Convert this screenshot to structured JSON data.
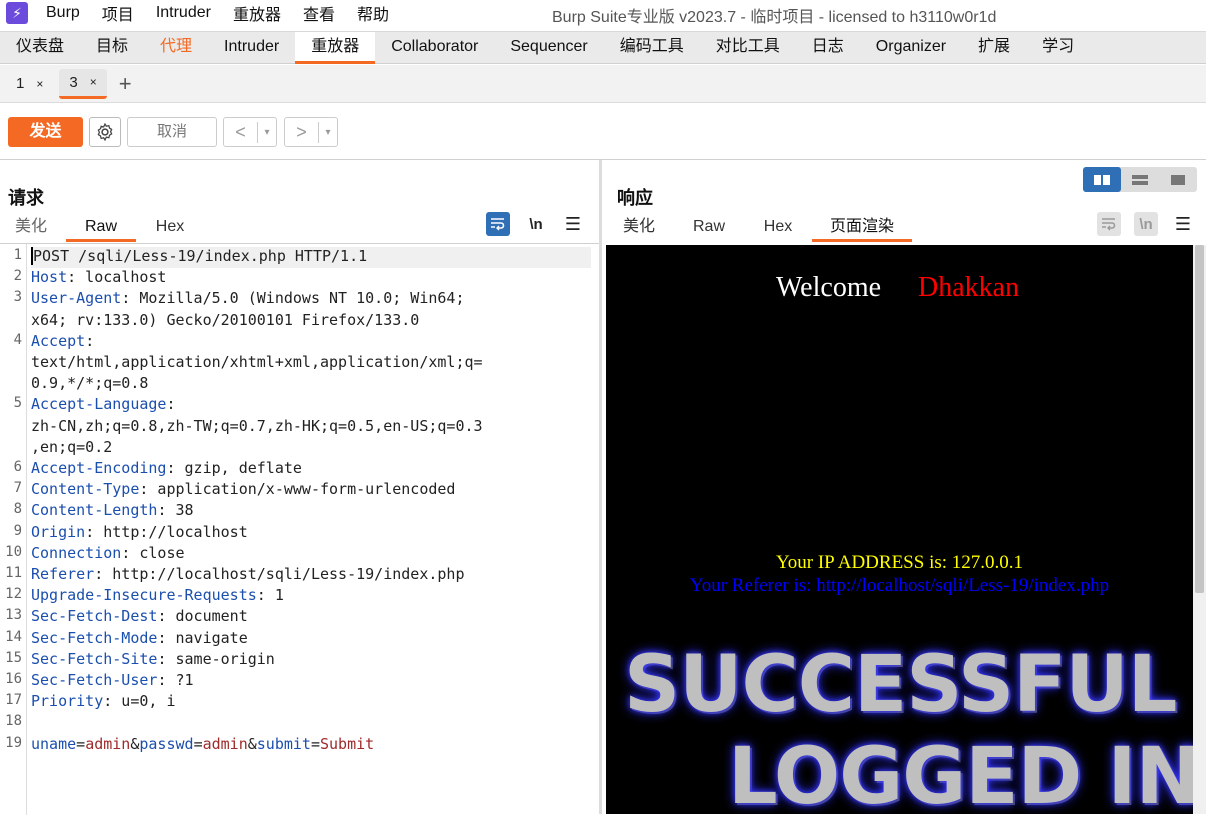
{
  "app": {
    "menu": [
      "Burp",
      "项目",
      "Intruder",
      "重放器",
      "查看",
      "帮助"
    ],
    "window_title": "Burp Suite专业版  v2023.7 - 临时项目 - licensed to h3110w0r1d",
    "logo_glyph": "⚡"
  },
  "main_tabs": [
    "仪表盘",
    "目标",
    "代理",
    "Intruder",
    "重放器",
    "Collaborator",
    "Sequencer",
    "编码工具",
    "对比工具",
    "日志",
    "Organizer",
    "扩展",
    "学习"
  ],
  "sub_tabs": [
    {
      "label": "1",
      "close": "×"
    },
    {
      "label": "3",
      "close": "×"
    }
  ],
  "sub_tab_add": "+",
  "toolbar": {
    "send_label": "发送",
    "cancel_label": "取消",
    "back_glyph": "<",
    "forward_glyph": ">",
    "dropdown_glyph": "▾"
  },
  "request": {
    "title": "请求",
    "tabs": [
      "美化",
      "Raw",
      "Hex"
    ],
    "active_tab": "Raw",
    "lines": [
      {
        "n": "1",
        "parts": [
          [
            "POST /sqli/Less-19/index.php HTTP/1.1",
            ""
          ]
        ]
      },
      {
        "n": "2",
        "parts": [
          [
            "Host",
            "k"
          ],
          [
            ": localhost",
            ""
          ]
        ]
      },
      {
        "n": "3",
        "parts": [
          [
            "User-Agent",
            "k"
          ],
          [
            ": Mozilla/5.0 (Windows NT 10.0; Win64;",
            ""
          ]
        ]
      },
      {
        "n": "",
        "parts": [
          [
            "x64; rv:133.0) Gecko/20100101 Firefox/133.0",
            ""
          ]
        ]
      },
      {
        "n": "4",
        "parts": [
          [
            "Accept",
            "k"
          ],
          [
            ":",
            ""
          ]
        ]
      },
      {
        "n": "",
        "parts": [
          [
            "text/html,application/xhtml+xml,application/xml;q=",
            ""
          ]
        ]
      },
      {
        "n": "",
        "parts": [
          [
            "0.9,*/*;q=0.8",
            ""
          ]
        ]
      },
      {
        "n": "5",
        "parts": [
          [
            "Accept-Language",
            "k"
          ],
          [
            ":",
            ""
          ]
        ]
      },
      {
        "n": "",
        "parts": [
          [
            "zh-CN,zh;q=0.8,zh-TW;q=0.7,zh-HK;q=0.5,en-US;q=0.3",
            ""
          ]
        ]
      },
      {
        "n": "",
        "parts": [
          [
            ",en;q=0.2",
            ""
          ]
        ]
      },
      {
        "n": "6",
        "parts": [
          [
            "Accept-Encoding",
            "k"
          ],
          [
            ": gzip, deflate",
            ""
          ]
        ]
      },
      {
        "n": "7",
        "parts": [
          [
            "Content-Type",
            "k"
          ],
          [
            ": application/x-www-form-urlencoded",
            ""
          ]
        ]
      },
      {
        "n": "8",
        "parts": [
          [
            "Content-Length",
            "k"
          ],
          [
            ": 38",
            ""
          ]
        ]
      },
      {
        "n": "9",
        "parts": [
          [
            "Origin",
            "k"
          ],
          [
            ": http://localhost",
            ""
          ]
        ]
      },
      {
        "n": "10",
        "parts": [
          [
            "Connection",
            "k"
          ],
          [
            ": close",
            ""
          ]
        ]
      },
      {
        "n": "11",
        "parts": [
          [
            "Referer",
            "k"
          ],
          [
            ": http://localhost/sqli/Less-19/index.php",
            ""
          ]
        ]
      },
      {
        "n": "12",
        "parts": [
          [
            "Upgrade-Insecure-Requests",
            "k"
          ],
          [
            ": 1",
            ""
          ]
        ]
      },
      {
        "n": "13",
        "parts": [
          [
            "Sec-Fetch-Dest",
            "k"
          ],
          [
            ": document",
            ""
          ]
        ]
      },
      {
        "n": "14",
        "parts": [
          [
            "Sec-Fetch-Mode",
            "k"
          ],
          [
            ": navigate",
            ""
          ]
        ]
      },
      {
        "n": "15",
        "parts": [
          [
            "Sec-Fetch-Site",
            "k"
          ],
          [
            ": same-origin",
            ""
          ]
        ]
      },
      {
        "n": "16",
        "parts": [
          [
            "Sec-Fetch-User",
            "k"
          ],
          [
            ": ?1",
            ""
          ]
        ]
      },
      {
        "n": "17",
        "parts": [
          [
            "Priority",
            "k"
          ],
          [
            ": u=0, i",
            ""
          ]
        ]
      },
      {
        "n": "18",
        "parts": []
      },
      {
        "n": "19",
        "parts": [
          [
            "uname",
            "k"
          ],
          [
            "=",
            ""
          ],
          [
            "admin",
            "pv"
          ],
          [
            "&",
            ""
          ],
          [
            "passwd",
            "k"
          ],
          [
            "=",
            ""
          ],
          [
            "admin",
            "pv"
          ],
          [
            "&",
            ""
          ],
          [
            "submit",
            "k"
          ],
          [
            "=",
            ""
          ],
          [
            "Submit",
            "pv"
          ]
        ]
      }
    ]
  },
  "response": {
    "title": "响应",
    "tabs": [
      "美化",
      "Raw",
      "Hex",
      "页面渲染"
    ],
    "active_tab": "页面渲染",
    "render": {
      "welcome": "Welcome",
      "name": "Dhakkan",
      "ip_line": "Your IP ADDRESS is: 127.0.0.1",
      "referer_line": "Your Referer is: http://localhost/sqli/Less-19/index.php",
      "banner_line1": "SUCCESSFUL",
      "banner_line2": "LOGGED IN"
    }
  },
  "icons": {
    "wrap": "wrap-lines-icon",
    "newline": "\\n",
    "menu": "☰"
  },
  "colors": {
    "accent": "#f46a24",
    "header_key": "#1b4fae",
    "param_value": "#9e2a2a"
  }
}
